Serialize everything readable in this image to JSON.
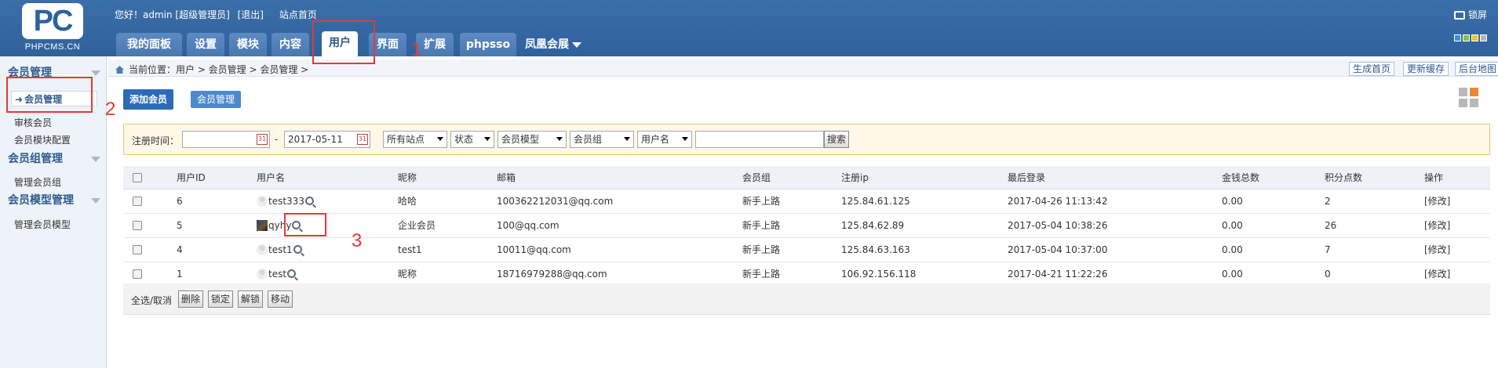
{
  "logo": {
    "caption": "PHPCMS.CN",
    "mark": "PC"
  },
  "topinfo": {
    "greeting": "您好！admin [超级管理员]",
    "logout": "[退出]",
    "site_home": "站点首页"
  },
  "lock": "锁屏",
  "nav": [
    {
      "label": "我的面板"
    },
    {
      "label": "设置"
    },
    {
      "label": "模块"
    },
    {
      "label": "内容"
    },
    {
      "label": "用户"
    },
    {
      "label": "界面"
    },
    {
      "label": "扩展"
    },
    {
      "label": "phpsso"
    },
    {
      "label": "凤凰会展"
    }
  ],
  "theme_colors": [
    "#3b8fd6",
    "#86c440",
    "#f1c232",
    "#b5b5b5"
  ],
  "sidebar": {
    "groups": [
      "会员管理",
      "会员组管理",
      "会员模型管理"
    ],
    "items": [
      "会员管理",
      "审核会员",
      "会员模块配置",
      "管理会员组",
      "管理会员模型"
    ]
  },
  "crumb": "当前位置：用户 > 会员管理 > 会员管理 >",
  "quick": [
    "生成首页",
    "更新缓存",
    "后台地图"
  ],
  "subtabs": [
    "添加会员",
    "会员管理"
  ],
  "filter": {
    "reg_label": "注册时间：",
    "date_from": "",
    "sep": "-",
    "date_to": "2017-05-11",
    "site": "所有站点",
    "status": "状态",
    "model": "会员模型",
    "group": "会员组",
    "field": "用户名",
    "keyword": "",
    "search": "搜索"
  },
  "table": {
    "headers": [
      "用户ID",
      "用户名",
      "昵称",
      "邮箱",
      "会员组",
      "注册ip",
      "最后登录",
      "金钱总数",
      "积分点数",
      "操作"
    ],
    "rows": [
      {
        "id": "6",
        "user": "test333",
        "nick": "哈哈",
        "email": "100362212031@qq.com",
        "group": "新手上路",
        "ip": "125.84.61.125",
        "last": "2017-04-26 11:13:42",
        "money": "0.00",
        "points": "2",
        "op": "[修改]",
        "avatar": "default"
      },
      {
        "id": "5",
        "user": "qyhy",
        "nick": "企业会员",
        "email": "100@qq.com",
        "group": "新手上路",
        "ip": "125.84.62.89",
        "last": "2017-05-04 10:38:26",
        "money": "0.00",
        "points": "26",
        "op": "[修改]",
        "avatar": "photo"
      },
      {
        "id": "4",
        "user": "test1",
        "nick": "test1",
        "email": "10011@qq.com",
        "group": "新手上路",
        "ip": "125.84.63.163",
        "last": "2017-05-04 10:37:00",
        "money": "0.00",
        "points": "7",
        "op": "[修改]",
        "avatar": "default"
      },
      {
        "id": "1",
        "user": "test",
        "nick": "昵称",
        "email": "18716979288@qq.com",
        "group": "新手上路",
        "ip": "106.92.156.118",
        "last": "2017-04-21 11:22:26",
        "money": "0.00",
        "points": "0",
        "op": "[修改]",
        "avatar": "default"
      }
    ]
  },
  "bottom": {
    "select_all": "全选/取消",
    "buttons": [
      "删除",
      "锁定",
      "解锁",
      "移动"
    ]
  },
  "annotations": [
    "1",
    "2",
    "3"
  ],
  "accent": "#2f619c",
  "annotation_color": "#e53935"
}
